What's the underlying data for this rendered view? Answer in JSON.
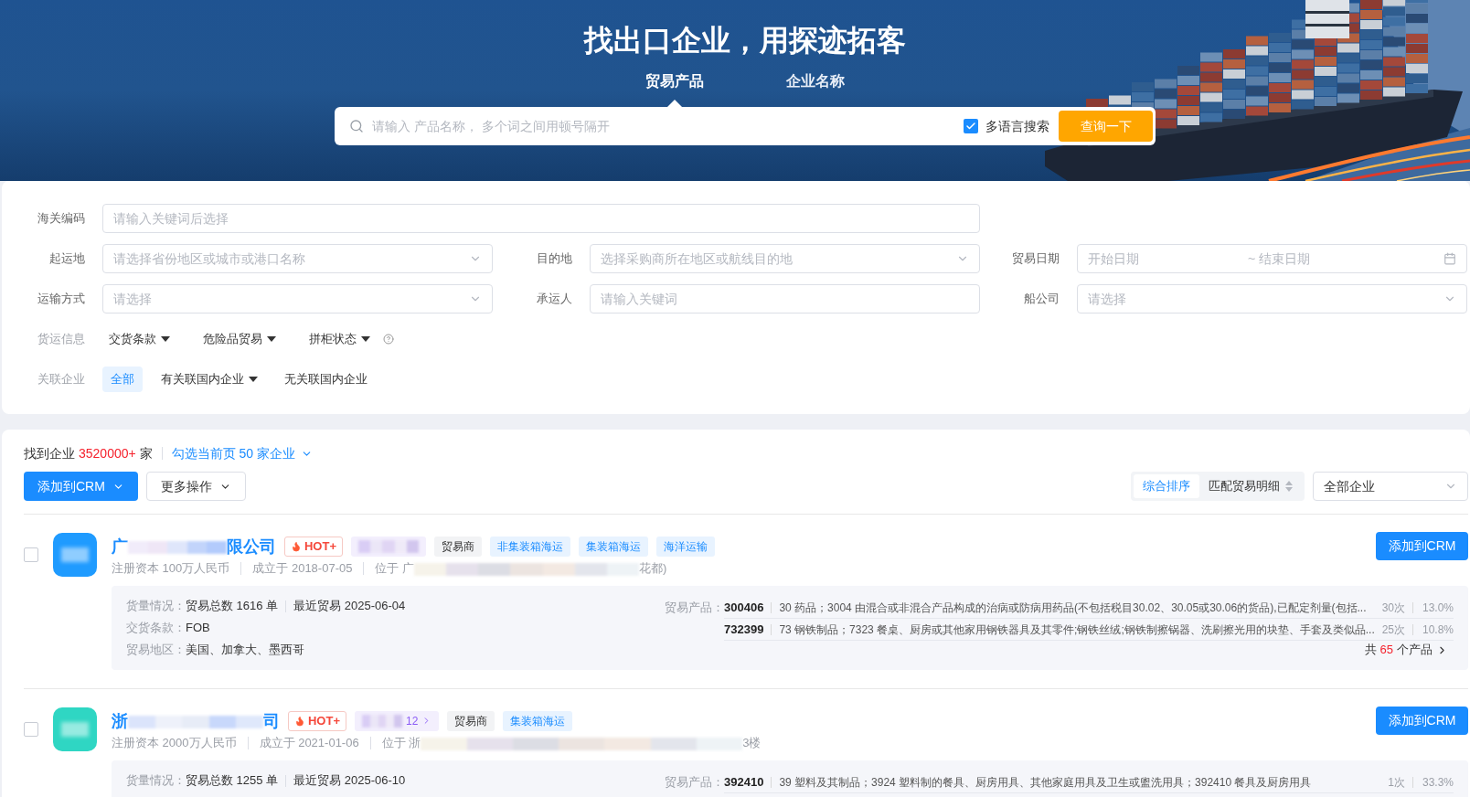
{
  "banner": {
    "title": "找出口企业，用探迹拓客",
    "tabs": [
      {
        "label": "贸易产品",
        "selected": true
      },
      {
        "label": "企业名称",
        "selected": false
      }
    ],
    "search": {
      "placeholder": "请输入 产品名称， 多个词之间用顿号隔开",
      "option": {
        "label": "多语言搜索",
        "checked": true
      },
      "button": "查询一下"
    }
  },
  "filters": {
    "rows": [
      [
        {
          "label": "海关编码",
          "kind": "input",
          "placeholder": "请输入关键词后选择"
        }
      ],
      [
        {
          "label": "起运地",
          "kind": "select",
          "placeholder": "请选择省份地区或城市或港口名称"
        },
        {
          "label": "目的地",
          "kind": "select",
          "placeholder": "选择采购商所在地区或航线目的地"
        },
        {
          "label": "贸易日期",
          "kind": "daterange",
          "placeholder": "开始日期",
          "separator": "~",
          "end_placeholder": "结束日期"
        }
      ],
      [
        {
          "label": "运输方式",
          "kind": "select",
          "placeholder": "请选择"
        },
        {
          "label": "承运人",
          "kind": "input",
          "placeholder": "请输入关键词"
        },
        {
          "label": "船公司",
          "kind": "select",
          "placeholder": "请选择"
        }
      ]
    ],
    "cargo": {
      "label": "货运信息",
      "dropdowns": [
        {
          "label": "交货条款",
          "help": false
        },
        {
          "label": "危险品贸易",
          "help": false
        },
        {
          "label": "拼柜状态",
          "help": true
        }
      ]
    },
    "related": {
      "label": "关联企业",
      "options": [
        {
          "label": "全部",
          "kind": "option",
          "selected": true
        },
        {
          "label": "有关联国内企业",
          "kind": "dropdown",
          "selected": false
        },
        {
          "label": "无关联国内企业",
          "kind": "option",
          "selected": false
        }
      ]
    }
  },
  "results": {
    "found_prefix": "找到企业",
    "count": "3520000+",
    "found_suffix": "家",
    "select_page": "勾选当前页 50 家企业",
    "actions": [
      {
        "label": "添加到CRM",
        "kind": "primary"
      },
      {
        "label": "更多操作",
        "kind": "default"
      }
    ],
    "sort": [
      {
        "label": "综合排序",
        "kind": "plain",
        "selected": true
      },
      {
        "label": "匹配贸易明细",
        "kind": "sortable",
        "selected": false
      }
    ],
    "scope": {
      "value": "全部企业"
    },
    "companies": [
      {
        "checked": false,
        "color": "#1f9bff",
        "name_start": "广",
        "name_end": "限公司",
        "tags": [
          {
            "kind": "hot",
            "label": "HOT+"
          },
          {
            "kind": "group"
          },
          {
            "kind": "plain",
            "label": "贸易商"
          },
          {
            "kind": "blue",
            "label": "非集装箱海运"
          },
          {
            "kind": "blue",
            "label": "集装箱海运"
          },
          {
            "kind": "blue",
            "label": "海洋运输"
          }
        ],
        "button": "添加到CRM",
        "capital": "注册资本 100万人民币",
        "founded": "成立于 2018-07-05",
        "address_start": "位于 广",
        "address_end": "花都)",
        "stats": [
          {
            "label": "货量情况：",
            "values": [
              "贸易总数 1616 单",
              "最近贸易 2025-06-04"
            ]
          },
          {
            "label": "交货条款：",
            "values": [
              "FOB"
            ]
          },
          {
            "label": "贸易地区：",
            "values": [
              "美国、加拿大、墨西哥"
            ]
          }
        ],
        "products": {
          "label": "贸易产品：",
          "items": [
            {
              "code": "300406",
              "description": "30 药品；3004 由混合或非混合产品构成的治病或防病用药品(不包括税目30.02、30.05或30.06的货品),已配定剂量(包括...",
              "times": "30次",
              "share": "13.0%"
            },
            {
              "code": "732399",
              "description": "73 钢铁制品；7323 餐桌、厨房或其他家用钢铁器具及其零件;钢铁丝绒;钢铁制擦锅器、洗刷擦光用的块垫、手套及类似品...",
              "times": "25次",
              "share": "10.8%"
            }
          ],
          "total": {
            "prefix": "共",
            "count": "65",
            "suffix": "个产品"
          }
        }
      },
      {
        "checked": false,
        "color": "#2fd6c3",
        "name_start": "浙",
        "name_end": "司",
        "tags": [
          {
            "kind": "hot",
            "label": "HOT+"
          },
          {
            "kind": "group",
            "count": "12"
          },
          {
            "kind": "plain",
            "label": "贸易商"
          },
          {
            "kind": "blue",
            "label": "集装箱海运"
          }
        ],
        "button": "添加到CRM",
        "capital": "注册资本 2000万人民币",
        "founded": "成立于 2021-01-06",
        "address_start": "位于 浙",
        "address_end": "3楼",
        "stats": [
          {
            "label": "货量情况：",
            "values": [
              "贸易总数 1255 单",
              "最近贸易 2025-06-10"
            ]
          }
        ],
        "products": {
          "label": "贸易产品：",
          "items": [
            {
              "code": "392410",
              "description": "39 塑料及其制品；3924 塑料制的餐具、厨房用具、其他家庭用具及卫生或盥洗用具；392410 餐具及厨房用具",
              "times": "1次",
              "share": "33.3%"
            }
          ]
        }
      }
    ]
  }
}
